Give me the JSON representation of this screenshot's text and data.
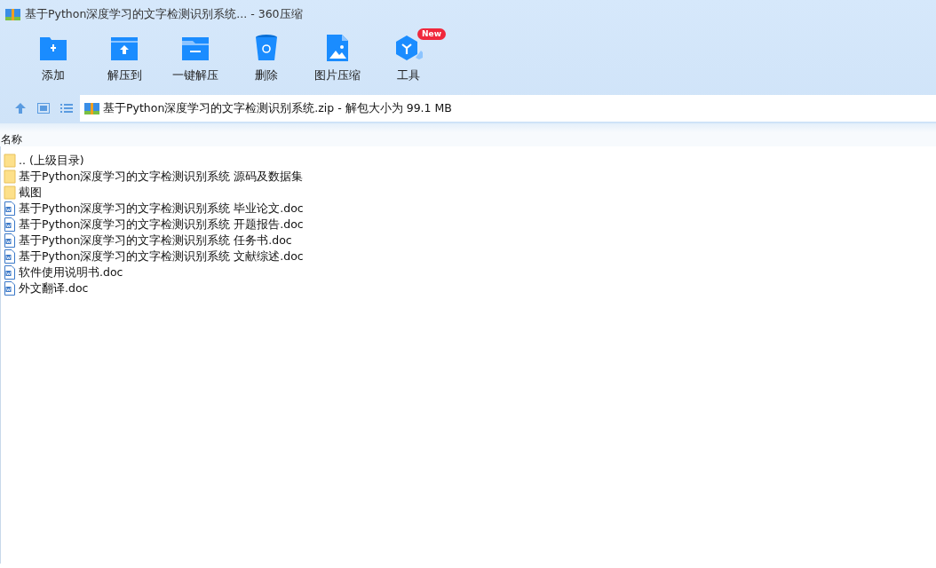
{
  "window": {
    "title": "基于Python深度学习的文字检测识别系统... - 360压缩"
  },
  "toolbar": [
    {
      "kind": "add",
      "label": "添加"
    },
    {
      "kind": "extract",
      "label": "解压到"
    },
    {
      "kind": "oneclick",
      "label": "一键解压"
    },
    {
      "kind": "delete",
      "label": "删除"
    },
    {
      "kind": "image",
      "label": "图片压缩"
    },
    {
      "kind": "tools",
      "label": "工具",
      "badge": "New"
    }
  ],
  "address": {
    "text": "基于Python深度学习的文字检测识别系统.zip - 解包大小为 99.1 MB"
  },
  "table": {
    "columns": [
      "名称"
    ],
    "rows": [
      {
        "kind": "folder",
        "name": ".. (上级目录)"
      },
      {
        "kind": "folder",
        "name": "基于Python深度学习的文字检测识别系统 源码及数据集"
      },
      {
        "kind": "folder",
        "name": "截图"
      },
      {
        "kind": "doc",
        "name": "基于Python深度学习的文字检测识别系统 毕业论文.doc"
      },
      {
        "kind": "doc",
        "name": "基于Python深度学习的文字检测识别系统 开题报告.doc"
      },
      {
        "kind": "doc",
        "name": "基于Python深度学习的文字检测识别系统 任务书.doc"
      },
      {
        "kind": "doc",
        "name": "基于Python深度学习的文字检测识别系统 文献综述.doc"
      },
      {
        "kind": "doc",
        "name": "软件使用说明书.doc"
      },
      {
        "kind": "doc",
        "name": "外文翻译.doc"
      }
    ]
  }
}
